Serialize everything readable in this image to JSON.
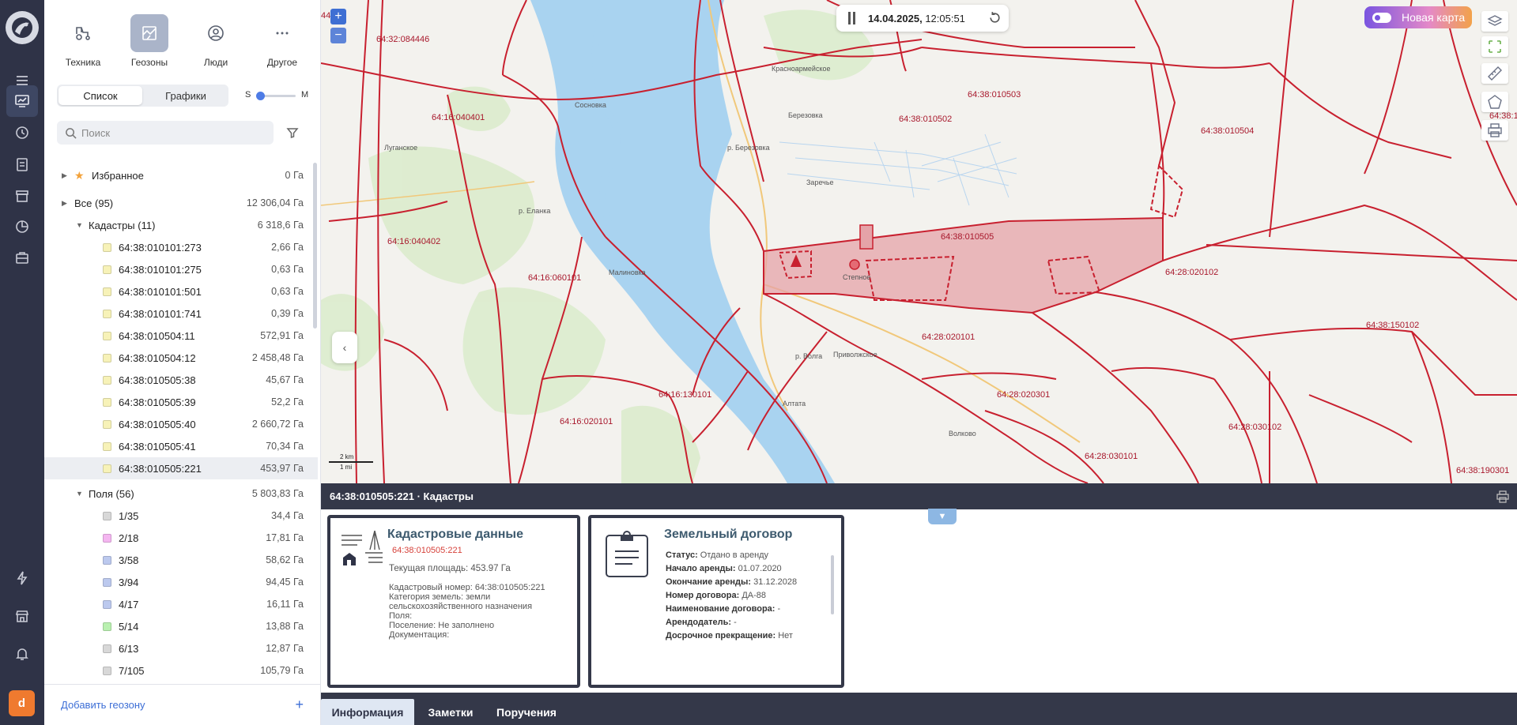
{
  "categories": [
    {
      "label": "Техника",
      "icon": "tractor-icon"
    },
    {
      "label": "Геозоны",
      "icon": "geozone-icon"
    },
    {
      "label": "Люди",
      "icon": "person-icon"
    },
    {
      "label": "Другое",
      "icon": "more-icon"
    }
  ],
  "view_toggle": {
    "list": "Список",
    "charts": "Графики"
  },
  "size_slider": {
    "min_label": "S",
    "max_label": "M",
    "level": 0
  },
  "search": {
    "placeholder": "Поиск"
  },
  "tree": {
    "favorites": {
      "label": "Избранное",
      "value": "0 Га"
    },
    "all": {
      "label": "Все  (95)",
      "value": "12 306,04 Га"
    },
    "cadastre_group": {
      "label": "Кадастры  (11)",
      "value": "6 318,6 Га"
    },
    "cadastre_items": [
      {
        "label": "64:38:010101:273",
        "value": "2,66 Га"
      },
      {
        "label": "64:38:010101:275",
        "value": "0,63 Га"
      },
      {
        "label": "64:38:010101:501",
        "value": "0,63 Га"
      },
      {
        "label": "64:38:010101:741",
        "value": "0,39 Га"
      },
      {
        "label": "64:38:010504:11",
        "value": "572,91 Га"
      },
      {
        "label": "64:38:010504:12",
        "value": "2 458,48 Га"
      },
      {
        "label": "64:38:010505:38",
        "value": "45,67 Га"
      },
      {
        "label": "64:38:010505:39",
        "value": "52,2 Га"
      },
      {
        "label": "64:38:010505:40",
        "value": "2 660,72 Га"
      },
      {
        "label": "64:38:010505:41",
        "value": "70,34 Га"
      },
      {
        "label": "64:38:010505:221",
        "value": "453,97 Га"
      }
    ],
    "fields_group": {
      "label": "Поля  (56)",
      "value": "5 803,83 Га"
    },
    "field_items": [
      {
        "label": "1/35",
        "value": "34,4 Га",
        "color": "#d8d8d8"
      },
      {
        "label": "2/18",
        "value": "17,81 Га",
        "color": "#f4b6f0"
      },
      {
        "label": "3/58",
        "value": "58,62 Га",
        "color": "#bcc9ee"
      },
      {
        "label": "3/94",
        "value": "94,45 Га",
        "color": "#bcc9ee"
      },
      {
        "label": "4/17",
        "value": "16,11 Га",
        "color": "#bcc9ee"
      },
      {
        "label": "5/14",
        "value": "13,88 Га",
        "color": "#b9f0b0"
      },
      {
        "label": "6/13",
        "value": "12,87 Га",
        "color": "#d8d8d8"
      },
      {
        "label": "7/105",
        "value": "105,79 Га",
        "color": "#d8d8d8"
      }
    ]
  },
  "add_geozone": "Добавить геозону",
  "map": {
    "timestamp_date": "14.04.2025,",
    "timestamp_time": "12:05:51",
    "new_map": "Новая карта",
    "zoom_in": "+",
    "zoom_out": "−",
    "scale_km": "2 km",
    "scale_mi": "1 mi",
    "parcel_labels": [
      "64:32:084446",
      "64:38:010503",
      "64:38:010502",
      "64:16:040401",
      "64:38:010504",
      "64:38:010505",
      "64:16:040402",
      "64:16:060101",
      "64:28:020102",
      "64:28:020101",
      "64:38:150102",
      "64:16:130101",
      "64:28:020301",
      "64:16:020101",
      "64:28:030102",
      "64:28:030101",
      "64:38:190301",
      "64:38:1",
      "44"
    ],
    "town_labels": [
      "Красноармейское",
      "Сосновка",
      "Березовка",
      "Луганское",
      "Заречье",
      "р. Еланка",
      "р. Березовка",
      "Малиновка",
      "Степное",
      "Приволжское",
      "Алтата",
      "р. Волга",
      "Волково"
    ]
  },
  "info": {
    "header": "64:38:010505:221 · Кадастры",
    "cadastre_card": {
      "title": "Кадастровые данные",
      "id": "64:38:010505:221",
      "area": "Текущая площадь: 453.97 Га",
      "lines": [
        "Кадастровый номер: 64:38:010505:221",
        "Категория земель: земли",
        "сельскохозяйственного назначения",
        "Поля:",
        "Поселение: Не заполнено",
        "Документация:"
      ]
    },
    "contract_card": {
      "title": "Земельный договор",
      "rows": [
        {
          "k": "Статус:",
          "v": "Отдано в аренду"
        },
        {
          "k": "Начало аренды:",
          "v": "01.07.2020"
        },
        {
          "k": "Окончание аренды:",
          "v": "31.12.2028"
        },
        {
          "k": "Номер договора:",
          "v": "ДА-88"
        },
        {
          "k": "Наименование договора:",
          "v": "-"
        },
        {
          "k": "Арендодатель:",
          "v": "-"
        },
        {
          "k": "Досрочное прекращение:",
          "v": "Нет"
        }
      ]
    },
    "tabs": [
      "Информация",
      "Заметки",
      "Поручения"
    ]
  },
  "user": {
    "initial": "d"
  },
  "colors": {
    "accent": "#3c6ed6",
    "rail": "#2f3347",
    "parcel": "#c8202f",
    "water": "#a9d3f0",
    "highlight": "#e5a3a8"
  }
}
